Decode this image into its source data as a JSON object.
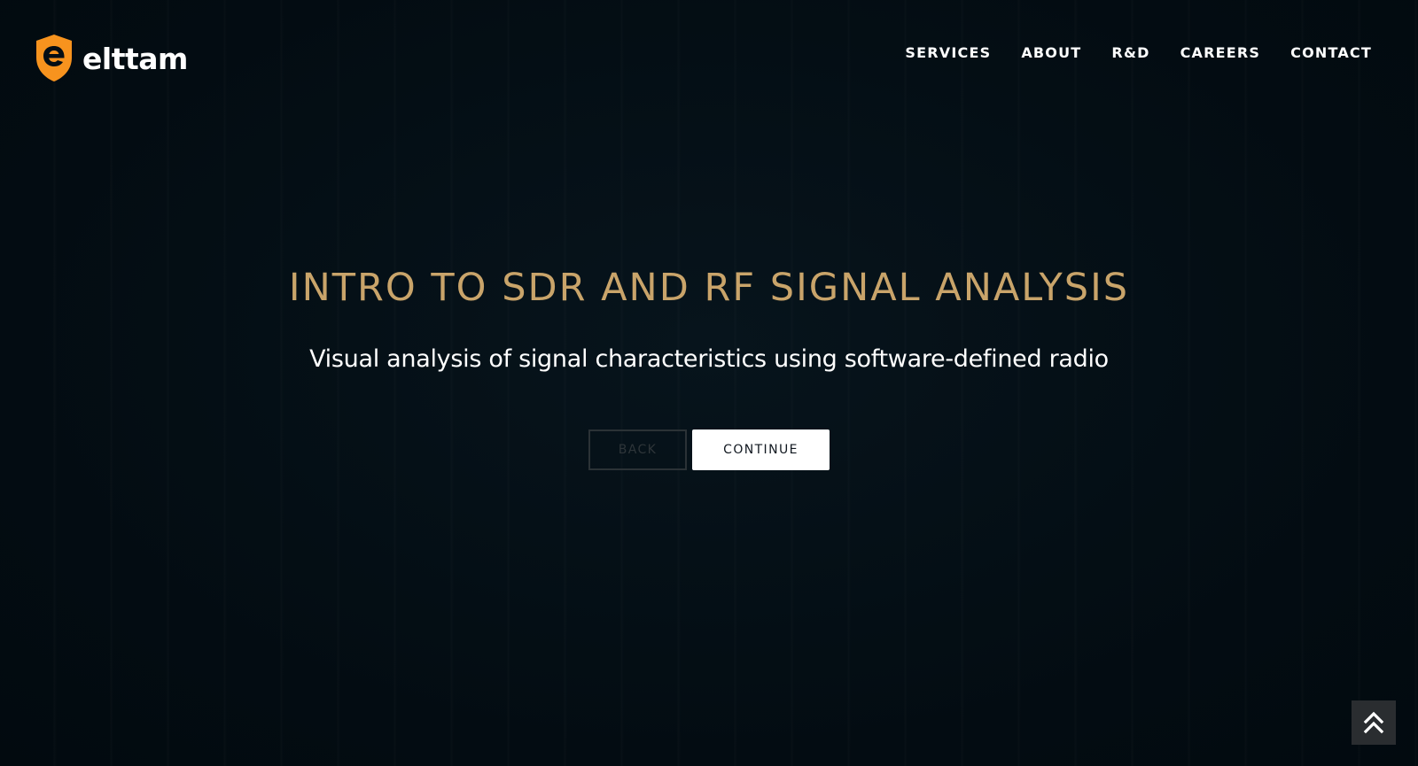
{
  "brand": {
    "name": "elttam",
    "logo_color": "#f7931e"
  },
  "nav": {
    "items": [
      {
        "label": "SERVICES"
      },
      {
        "label": "ABOUT"
      },
      {
        "label": "R&D"
      },
      {
        "label": "CAREERS"
      },
      {
        "label": "CONTACT"
      }
    ]
  },
  "hero": {
    "title": "INTRO TO SDR AND RF SIGNAL ANALYSIS",
    "subtitle": "Visual analysis of signal characteristics using software-defined radio",
    "back_label": "BACK",
    "continue_label": "CONTINUE"
  },
  "scroll_top": {
    "icon": "double-chevron-up-icon"
  },
  "colors": {
    "background": "#040e15",
    "title": "#c9a46a",
    "accent": "#f7931e"
  }
}
